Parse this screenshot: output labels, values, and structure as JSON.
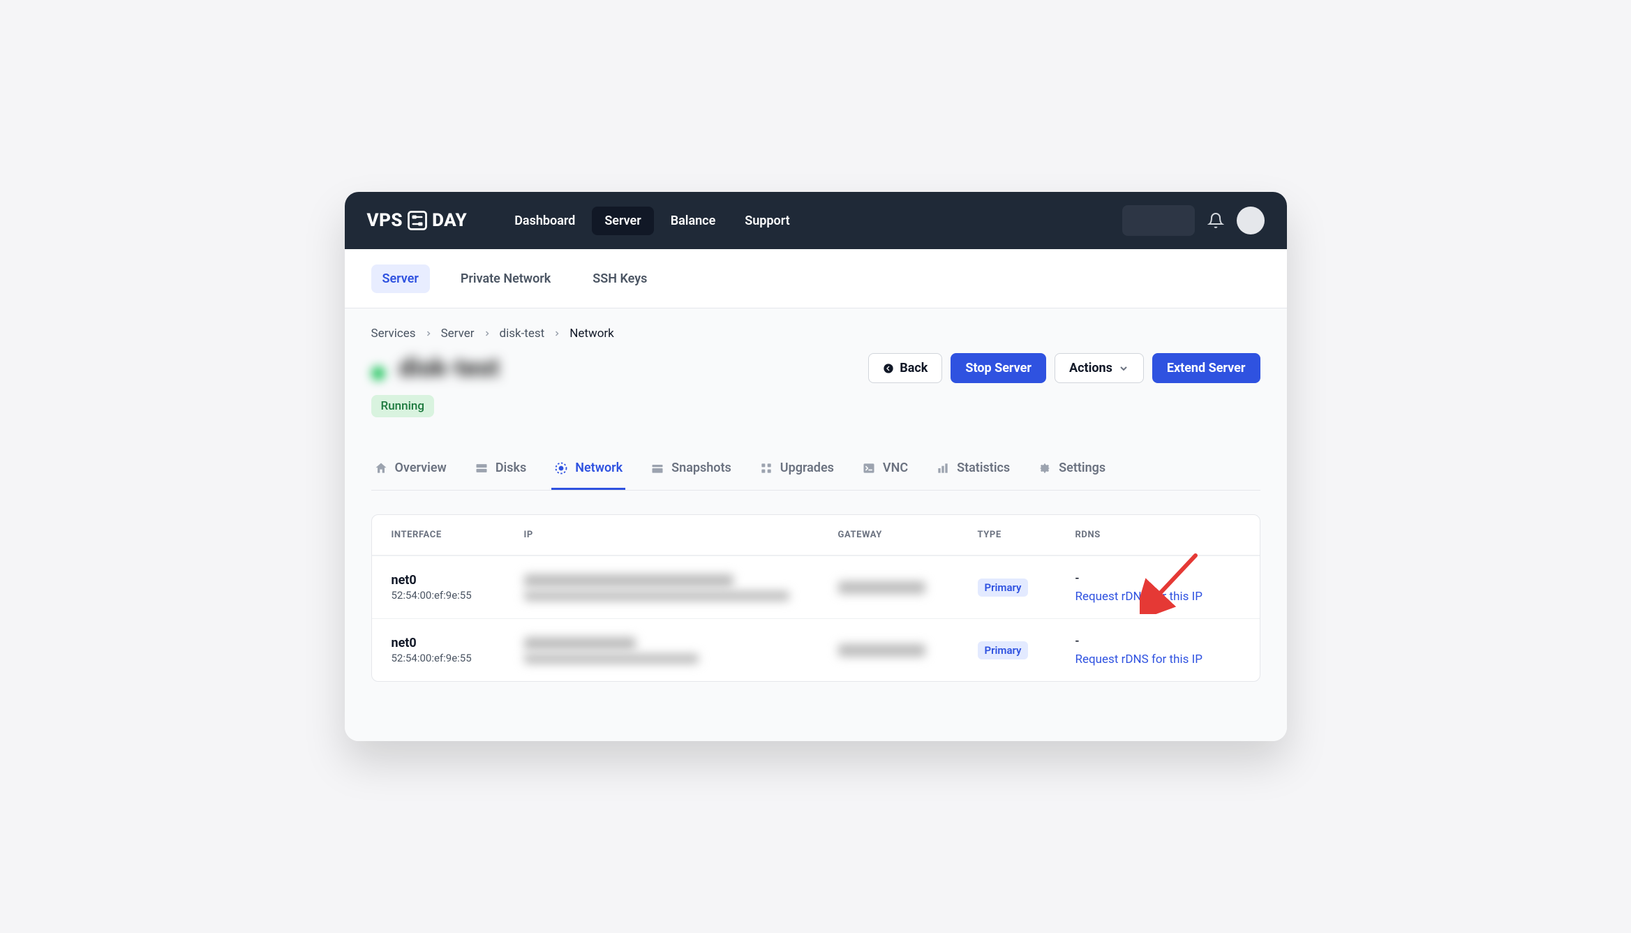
{
  "logo": {
    "text_left": "VPS",
    "text_right": "DAY"
  },
  "topnav": [
    "Dashboard",
    "Server",
    "Balance",
    "Support"
  ],
  "topnav_active": 1,
  "subnav": [
    "Server",
    "Private Network",
    "SSH Keys"
  ],
  "subnav_active": 0,
  "breadcrumb": [
    "Services",
    "Server",
    "disk-test",
    "Network"
  ],
  "server_title": "disk-test",
  "status": "Running",
  "actions": {
    "back": "Back",
    "stop": "Stop Server",
    "actions_menu": "Actions",
    "extend": "Extend Server"
  },
  "tabs": [
    {
      "id": "overview",
      "label": "Overview"
    },
    {
      "id": "disks",
      "label": "Disks"
    },
    {
      "id": "network",
      "label": "Network"
    },
    {
      "id": "snapshots",
      "label": "Snapshots"
    },
    {
      "id": "upgrades",
      "label": "Upgrades"
    },
    {
      "id": "vnc",
      "label": "VNC"
    },
    {
      "id": "statistics",
      "label": "Statistics"
    },
    {
      "id": "settings",
      "label": "Settings"
    }
  ],
  "tabs_active": 2,
  "table": {
    "headers": {
      "interface": "INTERFACE",
      "ip": "IP",
      "gateway": "GATEWAY",
      "type": "TYPE",
      "rdns": "RDNS"
    },
    "rows": [
      {
        "iface": "net0",
        "mac": "52:54:00:ef:9e:55",
        "type": "Primary",
        "rdns_value": "-",
        "rdns_action": "Request rDNS for this IP"
      },
      {
        "iface": "net0",
        "mac": "52:54:00:ef:9e:55",
        "type": "Primary",
        "rdns_value": "-",
        "rdns_action": "Request rDNS for this IP"
      }
    ]
  },
  "colors": {
    "primary": "#2f52e0",
    "danger_arrow": "#e53935"
  }
}
